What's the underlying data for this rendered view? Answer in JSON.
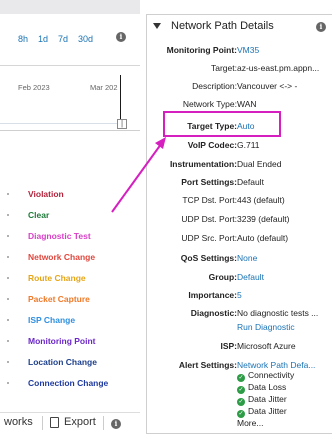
{
  "left": {
    "timeframes": [
      "8h",
      "1d",
      "7d",
      "30d"
    ],
    "chart_axis": [
      "Feb 2023",
      "Mar 202"
    ],
    "legend": [
      {
        "label": "Violation",
        "color": "#b3243c"
      },
      {
        "label": "Clear",
        "color": "#1f7a3a"
      },
      {
        "label": "Diagnostic Test",
        "color": "#d940c8"
      },
      {
        "label": "Network Change",
        "color": "#e0463d"
      },
      {
        "label": "Route Change",
        "color": "#e7a616"
      },
      {
        "label": "Packet Capture",
        "color": "#f07a2a"
      },
      {
        "label": "ISP Change",
        "color": "#2f8fe0"
      },
      {
        "label": "Monitoring Point",
        "color": "#6b27c8"
      },
      {
        "label": "Location Change",
        "color": "#1d3f8a"
      },
      {
        "label": "Connection Change",
        "color": "#1f3a9e"
      }
    ],
    "bottom": {
      "networks": "works",
      "export": "Export"
    }
  },
  "panel": {
    "title": "Network Path Details",
    "rows": [
      {
        "label": "Monitoring Point:",
        "value": "VM35",
        "link": true,
        "bold": true
      },
      {
        "label": "Target:",
        "value": "az-us-east.pm.appn...",
        "link": false,
        "bold": false
      },
      {
        "label": "Description:",
        "value": "Vancouver <-> -",
        "link": false,
        "bold": false
      },
      {
        "label": "Network Type:",
        "value": "WAN",
        "link": false,
        "bold": false
      },
      {
        "label": "Target Type:",
        "value": "Auto",
        "link": true,
        "bold": true
      },
      {
        "label": "VoIP Codec:",
        "value": "G.711",
        "link": false,
        "bold": true
      },
      {
        "label": "Instrumentation:",
        "value": "Dual Ended",
        "link": false,
        "bold": true
      },
      {
        "label": "Port Settings:",
        "value": "Default",
        "link": false,
        "bold": true
      },
      {
        "label": "TCP Dst. Port:",
        "value": "443 (default)",
        "link": false,
        "bold": false
      },
      {
        "label": "UDP Dst. Port:",
        "value": "3239 (default)",
        "link": false,
        "bold": false
      },
      {
        "label": "UDP Src. Port:",
        "value": "Auto (default)",
        "link": false,
        "bold": false
      },
      {
        "label": "QoS Settings:",
        "value": "None",
        "link": true,
        "bold": true
      },
      {
        "label": "Group:",
        "value": "Default",
        "link": true,
        "bold": true
      },
      {
        "label": "Importance:",
        "value": "5",
        "link": true,
        "bold": true
      },
      {
        "label": "Diagnostic:",
        "value": "No diagnostic tests ...",
        "link": false,
        "bold": true
      },
      {
        "label": "",
        "value": "Run Diagnostic",
        "link": true,
        "bold": false
      },
      {
        "label": "ISP:",
        "value": "Microsoft Azure",
        "link": false,
        "bold": true
      },
      {
        "label": "Alert Settings:",
        "value": "Network Path Defa...",
        "link": true,
        "bold": true
      }
    ],
    "alert_checks": [
      "Connectivity",
      "Data Loss",
      "Data Jitter",
      "Data Jitter"
    ],
    "more": "More..."
  },
  "annotation_color": "#d51fbf"
}
